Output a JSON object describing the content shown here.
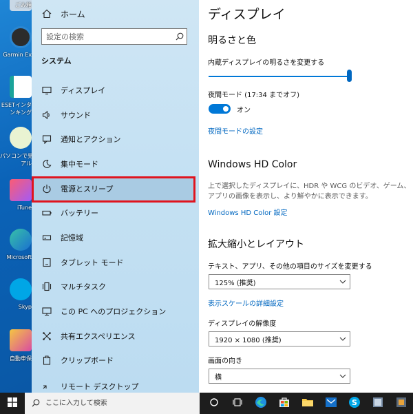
{
  "desktop": {
    "icons": [
      {
        "label": "ごみ箱"
      },
      {
        "label": "Garmin Ex"
      },
      {
        "label": "ESETインタ"
      },
      {
        "label": "ンキング"
      },
      {
        "label": "パソコンで見"
      },
      {
        "label": "アル"
      },
      {
        "label": "iTune"
      },
      {
        "label": "Microsoft"
      },
      {
        "label": "Skyp"
      },
      {
        "label": "自動車保"
      }
    ]
  },
  "nav": {
    "home_label": "ホーム",
    "search_placeholder": "設定の検索",
    "section_title": "システム",
    "items": [
      {
        "label": "ディスプレイ",
        "icon": "monitor-icon"
      },
      {
        "label": "サウンド",
        "icon": "speaker-icon"
      },
      {
        "label": "通知とアクション",
        "icon": "notification-icon"
      },
      {
        "label": "集中モード",
        "icon": "moon-icon"
      },
      {
        "label": "電源とスリープ",
        "icon": "power-icon"
      },
      {
        "label": "バッテリー",
        "icon": "battery-icon"
      },
      {
        "label": "記憶域",
        "icon": "storage-icon"
      },
      {
        "label": "タブレット モード",
        "icon": "tablet-icon"
      },
      {
        "label": "マルチタスク",
        "icon": "multitask-icon"
      },
      {
        "label": "この PC へのプロジェクション",
        "icon": "projection-icon"
      },
      {
        "label": "共有エクスペリエンス",
        "icon": "shared-icon"
      },
      {
        "label": "クリップボード",
        "icon": "clipboard-icon"
      },
      {
        "label": "リモート デスクトップ",
        "icon": "remote-icon"
      }
    ],
    "highlighted_index": 4,
    "highlight_color": "#e0141e"
  },
  "main": {
    "title": "ディスプレイ",
    "brightness": {
      "heading": "明るさと色",
      "label": "内蔵ディスプレイの明るさを変更する",
      "value_percent": 100
    },
    "night_mode": {
      "label": "夜間モード (17:34 までオフ)",
      "toggle_label": "オン",
      "settings_link": "夜間モードの設定"
    },
    "hd_color": {
      "heading": "Windows HD Color",
      "description": "上で選択したディスプレイに、HDR や WCG のビデオ、ゲーム、アプリの画像を表示し、より鮮やかに表示できます。",
      "link": "Windows HD Color 設定"
    },
    "scale": {
      "heading": "拡大縮小とレイアウト",
      "size_label": "テキスト、アプリ、その他の項目のサイズを変更する",
      "size_value": "125% (推奨)",
      "advanced_link": "表示スケールの詳細設定",
      "resolution_label": "ディスプレイの解像度",
      "resolution_value": "1920 × 1080 (推奨)",
      "orientation_label": "画面の向き",
      "orientation_value": "横"
    },
    "accent_color": "#0078d7"
  },
  "taskbar": {
    "search_placeholder": "ここに入力して検索"
  }
}
